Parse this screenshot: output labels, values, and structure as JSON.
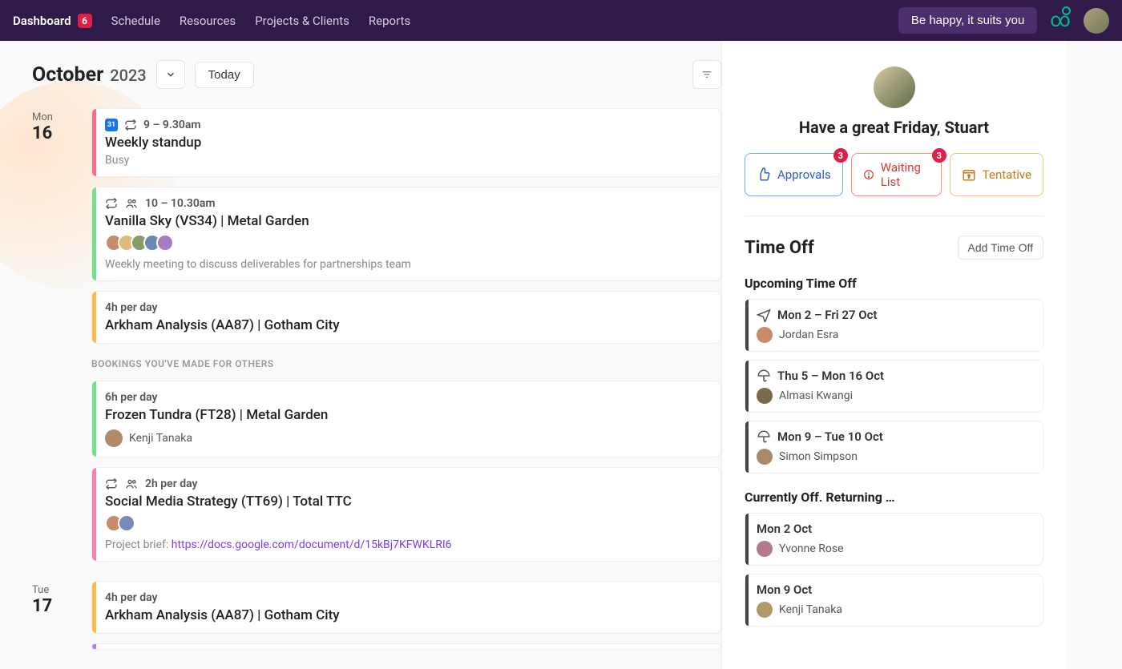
{
  "nav": {
    "dashboard": "Dashboard",
    "dashboard_badge": "6",
    "schedule": "Schedule",
    "resources": "Resources",
    "projects": "Projects & Clients",
    "reports": "Reports",
    "happy": "Be happy, it suits you"
  },
  "header": {
    "month": "October",
    "year": "2023",
    "today": "Today"
  },
  "days": [
    {
      "dow": "Mon",
      "dom": "16"
    },
    {
      "dow": "Tue",
      "dom": "17"
    }
  ],
  "events": {
    "standup_time": "9 – 9.30am",
    "standup_title": "Weekly standup",
    "standup_status": "Busy",
    "vanilla_time": "10 – 10.30am",
    "vanilla_title": "Vanilla Sky (VS34) | Metal Garden",
    "vanilla_note": "Weekly meeting to discuss deliverables for partnerships team",
    "arkham_meta": "4h per day",
    "arkham_title": "Arkham Analysis (AA87) | Gotham City",
    "others_label": "BOOKINGS YOU'VE MADE FOR OTHERS",
    "frozen_meta": "6h per day",
    "frozen_title": "Frozen Tundra (FT28) | Metal Garden",
    "frozen_person": "Kenji Tanaka",
    "social_meta": "2h per day",
    "social_title": "Social Media Strategy (TT69) | Total TTC",
    "social_note_prefix": "Project brief: ",
    "social_note_link": "https://docs.google.com/document/d/15kBj7KFWKLRI6",
    "arkham2_meta": "4h per day",
    "arkham2_title": "Arkham Analysis (AA87) | Gotham City"
  },
  "side": {
    "greet": "Have a great Friday, Stuart",
    "approvals": "Approvals",
    "approvals_count": "3",
    "waiting": "Waiting List",
    "waiting_count": "3",
    "tentative": "Tentative",
    "timeoff": "Time Off",
    "add": "Add Time Off",
    "upcoming": "Upcoming Time Off",
    "returning": "Currently Off. Returning …",
    "items": [
      {
        "range": "Mon 2 – Fri 27 Oct",
        "person": "Jordan Esra"
      },
      {
        "range": "Thu 5 – Mon 16 Oct",
        "person": "Almasi Kwangi"
      },
      {
        "range": "Mon 9 – Tue 10 Oct",
        "person": "Simon Simpson"
      }
    ],
    "ret": [
      {
        "range": "Mon 2 Oct",
        "person": "Yvonne Rose"
      },
      {
        "range": "Mon 9 Oct",
        "person": "Kenji Tanaka"
      }
    ]
  },
  "gcal_glyph": "31"
}
